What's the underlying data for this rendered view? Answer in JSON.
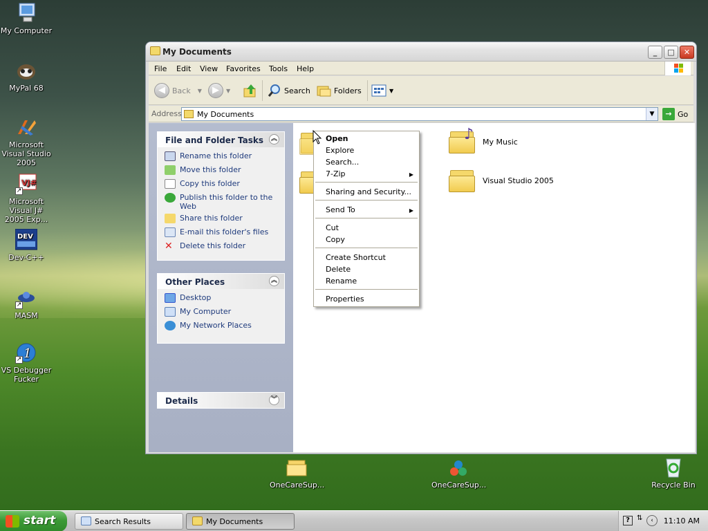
{
  "desktop": {
    "icons": [
      {
        "label": "My Computer",
        "icon": "computer-icon"
      },
      {
        "label": "MyPal 68",
        "icon": "mypal-browser-icon"
      },
      {
        "label": "Microsoft Visual Studio 2005",
        "icon": "visual-studio-icon"
      },
      {
        "label": "Microsoft Visual J# 2005 Exp...",
        "icon": "visual-jsharp-icon"
      },
      {
        "label": "Dev-C++",
        "icon": "dev-cpp-icon"
      },
      {
        "label": "MASM",
        "icon": "masm-icon"
      },
      {
        "label": "VS Debugger Fucker",
        "icon": "vs-debugger-icon"
      },
      {
        "label": "OneCareSup...",
        "icon": "folder-icon"
      },
      {
        "label": "OneCareSup...",
        "icon": "onecare-icon"
      },
      {
        "label": "Recycle Bin",
        "icon": "recycle-bin-icon"
      }
    ]
  },
  "window": {
    "title": "My Documents",
    "menu": [
      "File",
      "Edit",
      "View",
      "Favorites",
      "Tools",
      "Help"
    ],
    "toolbar": {
      "back": "Back",
      "search": "Search",
      "folders": "Folders"
    },
    "address": {
      "label": "Address",
      "value": "My Documents",
      "go": "Go"
    },
    "tasks_panel": {
      "title": "File and Folder Tasks",
      "items": [
        "Rename this folder",
        "Move this folder",
        "Copy this folder",
        "Publish this folder to the Web",
        "Share this folder",
        "E-mail this folder's files",
        "Delete this folder"
      ]
    },
    "places_panel": {
      "title": "Other Places",
      "items": [
        "Desktop",
        "My Computer",
        "My Network Places"
      ]
    },
    "details_panel": {
      "title": "Details"
    },
    "folders": [
      "My Music",
      "Visual Studio 2005"
    ]
  },
  "context_menu": {
    "items": [
      "Open",
      "Explore",
      "Search...",
      "7-Zip",
      "Sharing and Security...",
      "Send To",
      "Cut",
      "Copy",
      "Create Shortcut",
      "Delete",
      "Rename",
      "Properties"
    ]
  },
  "taskbar": {
    "start": "start",
    "tasks": [
      "Search Results",
      "My Documents"
    ],
    "clock": "11:10 AM"
  },
  "colors": {
    "task_link": "#1e3a7c",
    "start_green": "#3c9a36"
  }
}
